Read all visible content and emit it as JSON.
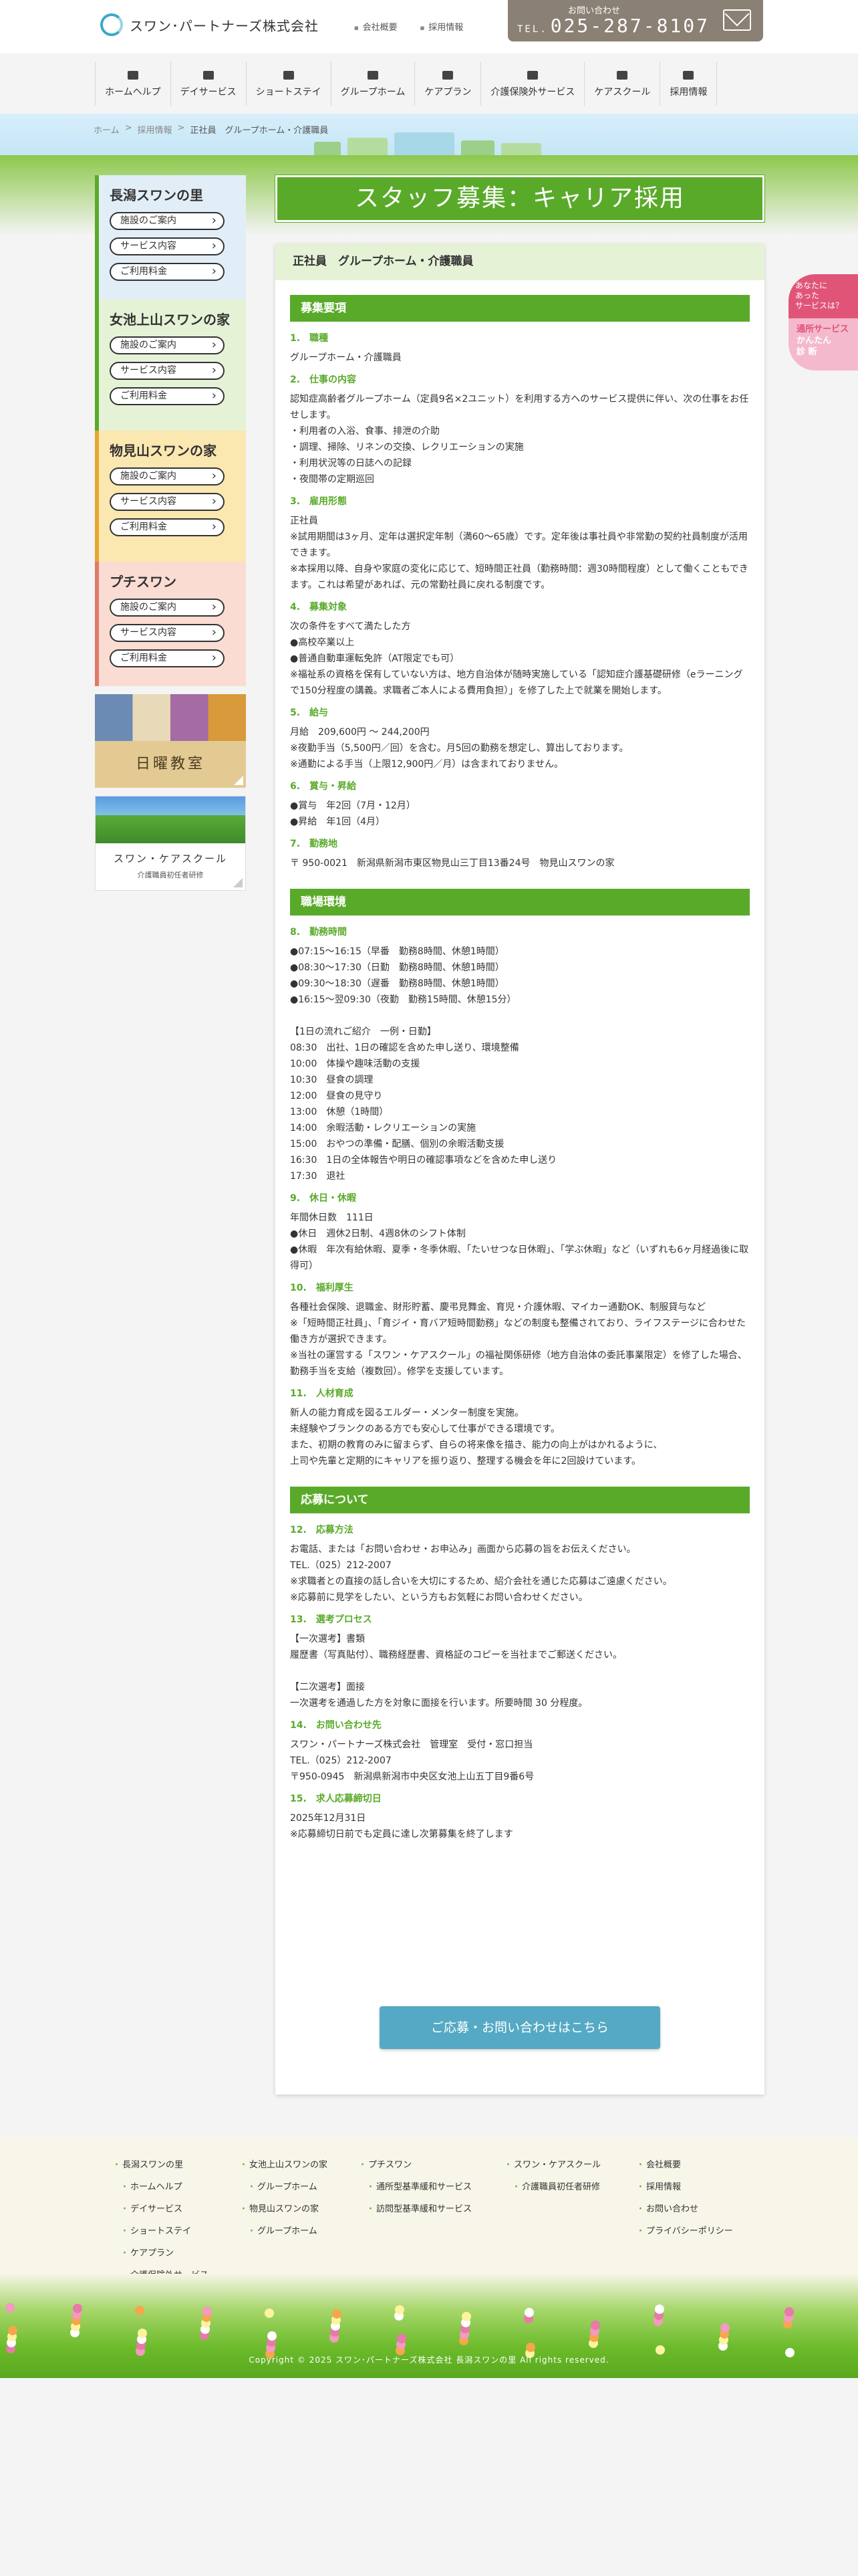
{
  "header": {
    "logo_text": "スワン･パートナーズ株式会社",
    "links": [
      "会社概要",
      "採用情報"
    ],
    "tel_label": "お問い合わせ",
    "tel_prefix": "TEL.",
    "tel_number": "025-287-8107"
  },
  "nav": [
    "ホームヘルプ",
    "デイサービス",
    "ショートステイ",
    "グループホーム",
    "ケアプラン",
    "介護保険外サービス",
    "ケアスクール",
    "採用情報"
  ],
  "breadcrumb": [
    "ホーム",
    "採用情報",
    "正社員　グループホーム・介護職員"
  ],
  "sidebar": [
    {
      "title": "長潟スワンの里",
      "buttons": [
        "施設のご案内",
        "サービス内容",
        "ご利用料金"
      ]
    },
    {
      "title": "女池上山スワンの家",
      "buttons": [
        "施設のご案内",
        "サービス内容",
        "ご利用料金"
      ]
    },
    {
      "title": "物見山スワンの家",
      "buttons": [
        "施設のご案内",
        "サービス内容",
        "ご利用料金"
      ]
    },
    {
      "title": "プチスワン",
      "buttons": [
        "施設のご案内",
        "サービス内容",
        "ご利用料金"
      ]
    }
  ],
  "banners": {
    "sunday": "日曜教室",
    "care_title": "スワン・ケアスクール",
    "care_sub": "介護職員初任者研修"
  },
  "float_badge": {
    "top": "あなたに\nあった\nサービスは？",
    "bottom1": "通所サービス",
    "bottom2": "かんたん\n診 断"
  },
  "page_title": "スタッフ募集：キャリア採用",
  "card_title": "正社員　グループホーム・介護職員",
  "sections": [
    {
      "title": "募集要項",
      "items": [
        {
          "h": "1.　職種",
          "t": "グループホーム・介護職員"
        },
        {
          "h": "2.　仕事の内容",
          "t": "認知症高齢者グループホーム（定員9名×2ユニット）を利用する方へのサービス提供に伴い、次の仕事をお任せします。\n・利用者の入浴、食事、排泄の介助\n・調理、掃除、リネンの交換、レクリエーションの実施\n・利用状況等の日誌への記録\n・夜間帯の定期巡回"
        },
        {
          "h": "3.　雇用形態",
          "t": "正社員\n※試用期間は3ヶ月、定年は選択定年制（満60～65歳）です。定年後は事社員や非常勤の契約社員制度が活用できます。\n※本採用以降、自身や家庭の変化に応じて、短時間正社員（勤務時間：週30時間程度）として働くこともできます。これは希望があれば、元の常勤社員に戻れる制度です。"
        },
        {
          "h": "4.　募集対象",
          "t": "次の条件をすべて満たした方\n●高校卒業以上\n●普通自動車運転免許（AT限定でも可）\n※福祉系の資格を保有していない方は、地方自治体が随時実施している「認知症介護基礎研修（eラーニングで150分程度の講義。求職者ご本人による費用負担）」を修了した上で就業を開始します。"
        },
        {
          "h": "5.　給与",
          "t": "月給　209,600円 ～ 244,200円\n※夜勤手当（5,500円／回）を含む。月5回の勤務を想定し、算出しております。\n※通勤による手当（上限12,900円／月）は含まれておりません。"
        },
        {
          "h": "6.　賞与・昇給",
          "t": "●賞与　年2回（7月・12月）\n●昇給　年1回（4月）"
        },
        {
          "h": "7.　勤務地",
          "t": "〒 950-0021　新潟県新潟市東区物見山三丁目13番24号　物見山スワンの家"
        }
      ]
    },
    {
      "title": "職場環境",
      "items": [
        {
          "h": "8.　勤務時間",
          "t": "●07:15～16:15（早番　勤務8時間、休憩1時間）\n●08:30～17:30（日勤　勤務8時間、休憩1時間）\n●09:30～18:30（遅番　勤務8時間、休憩1時間）\n●16:15～翌09:30（夜勤　勤務15時間、休憩15分）\n\n【1日の流れご紹介　一例・日勤】\n08:30　出社、1日の確認を含めた申し送り、環境整備\n10:00　体操や趣味活動の支援\n10:30　昼食の調理\n12:00　昼食の見守り\n13:00　休憩（1時間）\n14:00　余暇活動・レクリエーションの実施\n15:00　おやつの準備・配膳、個別の余暇活動支援\n16:30　1日の全体報告や明日の確認事項などを含めた申し送り\n17:30　退社"
        },
        {
          "h": "9.　休日・休暇",
          "t": "年間休日数　111日\n●休日　週休2日制、4週8休のシフト体制\n●休暇　年次有給休暇、夏季・冬季休暇、「たいせつな日休暇」、「学ぶ休暇」など（いずれも6ヶ月経過後に取得可）"
        },
        {
          "h": "10.　福利厚生",
          "t": "各種社会保険、退職金、財形貯蓄、慶弔見舞金、育児・介護休暇、マイカー通勤OK、制服貸与など\n※「短時間正社員」、「育ジイ・育バア短時間勤務」などの制度も整備されており、ライフステージに合わせた働き方が選択できます。\n※当社の運営する「スワン・ケアスクール」の福祉関係研修（地方自治体の委託事業限定）を修了した場合、勤務手当を支給（複数回）。修学を支援しています。"
        },
        {
          "h": "11.　人材育成",
          "t": "新人の能力育成を図るエルダー・メンター制度を実施。\n未経験やブランクのある方でも安心して仕事ができる環境です。\nまた、初期の教育のみに留まらず、自らの将来像を描き、能力の向上がはかれるように、\n上司や先輩と定期的にキャリアを振り返り、整理する機会を年に2回設けています。"
        }
      ]
    },
    {
      "title": "応募について",
      "items": [
        {
          "h": "12.　応募方法",
          "t": "お電話、または「お問い合わせ・お申込み」画面から応募の旨をお伝えください。\nTEL.（025）212-2007\n※求職者との直接の話し合いを大切にするため、紹介会社を通じた応募はご遠慮ください。\n※応募前に見学をしたい、という方もお気軽にお問い合わせください。"
        },
        {
          "h": "13.　選考プロセス",
          "t": "【一次選考】書類\n履歴書（写真貼付）、職務経歴書、資格証のコピーを当社までご郵送ください。\n\n【二次選考】面接\n一次選考を通過した方を対象に面接を行います。所要時間 30 分程度。"
        },
        {
          "h": "14.　お問い合わせ先",
          "t": "スワン・パートナーズ株式会社　管理室　受付・窓口担当\nTEL.（025）212-2007\n〒950-0945　新潟県新潟市中央区女池上山五丁目9番6号"
        },
        {
          "h": "15.　求人応募締切日",
          "t": "2025年12月31日\n※応募締切日前でも定員に達し次第募集を終了します"
        }
      ]
    }
  ],
  "cta": "ご応募・お問い合わせはこちら",
  "footer": {
    "col1": {
      "head": "長潟スワンの里",
      "subs": [
        "ホームヘルプ",
        "デイサービス",
        "ショートステイ",
        "ケアプラン",
        "介護保険外サービス"
      ]
    },
    "col2": {
      "head": "女池上山スワンの家",
      "subs": [
        "グループホーム"
      ],
      "head2": "物見山スワンの家",
      "subs2": [
        "グループホーム"
      ]
    },
    "col3": {
      "head": "プチスワン",
      "subs": [
        "通所型基準緩和サービス",
        "訪問型基準緩和サービス"
      ]
    },
    "col4": {
      "head": "スワン・ケアスクール",
      "subs": [
        "介護職員初任者研修"
      ]
    },
    "col5": [
      "会社概要",
      "採用情報",
      "お問い合わせ",
      "プライバシーポリシー"
    ],
    "copyright": "Copyright © 2025 スワン･パートナーズ株式会社 長潟スワンの里 All rights reserved."
  }
}
